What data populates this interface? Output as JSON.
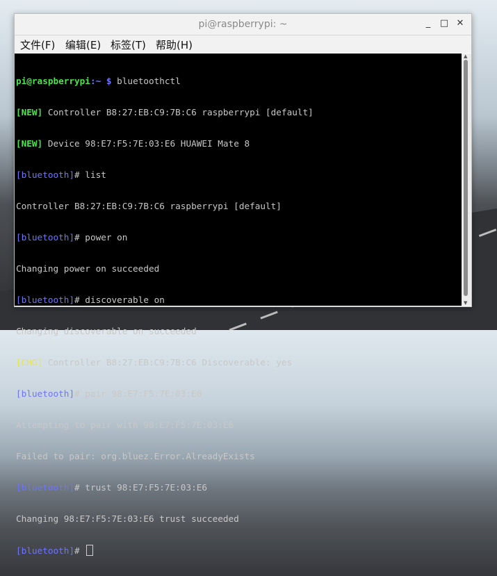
{
  "window": {
    "title": "pi@raspberrypi: ~"
  },
  "controls": {
    "minimize": "_",
    "maximize": "□",
    "close": "✕"
  },
  "menu": [
    "文件(F)",
    "编辑(E)",
    "标签(T)",
    "帮助(H)"
  ],
  "terminal": {
    "prompt_user": "pi@raspberrypi",
    "prompt_sep": ":~ $",
    "command": " bluetoothctl",
    "lines": [
      {
        "tag": "[NEW]",
        "text": " Controller B8:27:EB:C9:7B:C6 raspberrypi [default]"
      },
      {
        "tag": "[NEW]",
        "text": " Device 98:E7:F5:7E:03:E6 HUAWEI Mate 8"
      },
      {
        "prompt": "[bluetooth]",
        "text": "# list"
      },
      {
        "text": "Controller B8:27:EB:C9:7B:C6 raspberrypi [default]"
      },
      {
        "prompt": "[bluetooth]",
        "text": "# power on"
      },
      {
        "text": "Changing power on succeeded"
      },
      {
        "prompt": "[bluetooth]",
        "text": "# discoverable on"
      },
      {
        "text": "Changing discoverable on succeeded"
      },
      {
        "chg": "[CHG]",
        "text": " Controller B8:27:EB:C9:7B:C6 Discoverable: yes"
      },
      {
        "prompt": "[bluetooth]",
        "text": "# pair 98:E7:F5:7E:03:E6"
      },
      {
        "text": "Attempting to pair with 98:E7:F5:7E:03:E6"
      },
      {
        "text": "Failed to pair: org.bluez.Error.AlreadyExists"
      },
      {
        "prompt": "[bluetooth]",
        "text": "# trust 98:E7:F5:7E:03:E6"
      },
      {
        "text": "Changing 98:E7:F5:7E:03:E6 trust succeeded"
      },
      {
        "prompt": "[bluetooth]",
        "text": "# "
      }
    ]
  }
}
